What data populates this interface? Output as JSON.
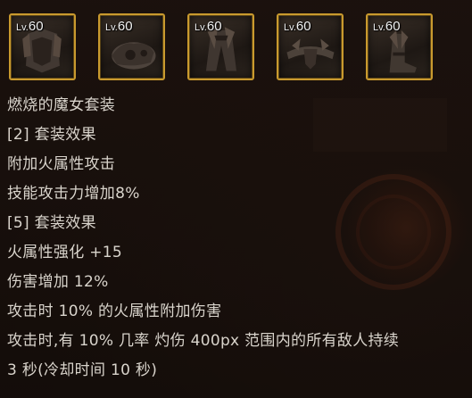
{
  "equipment": {
    "level_prefix": "Lv.",
    "items": [
      {
        "level": "60",
        "icon": "armor-chest-icon"
      },
      {
        "level": "60",
        "icon": "armor-shoulder-icon"
      },
      {
        "level": "60",
        "icon": "armor-pants-icon"
      },
      {
        "level": "60",
        "icon": "armor-belt-icon"
      },
      {
        "level": "60",
        "icon": "armor-boots-icon"
      }
    ]
  },
  "set": {
    "name": "燃烧的魔女套装",
    "bonus2_header": "[2] 套装效果",
    "bonus2_lines": [
      "附加火属性攻击",
      "技能攻击力增加8%"
    ],
    "bonus5_header": "[5] 套装效果",
    "bonus5_lines": [
      "火属性强化 +15",
      "伤害增加 12%",
      "攻击时 10% 的火属性附加伤害",
      "攻击时,有 10% 几率 灼伤 400px 范围内的所有敌人持续",
      "3 秒(冷却时间 10 秒)"
    ]
  },
  "colors": {
    "slot_border": "#c99a2e",
    "text": "#d9d4cc",
    "background": "#140c08"
  }
}
